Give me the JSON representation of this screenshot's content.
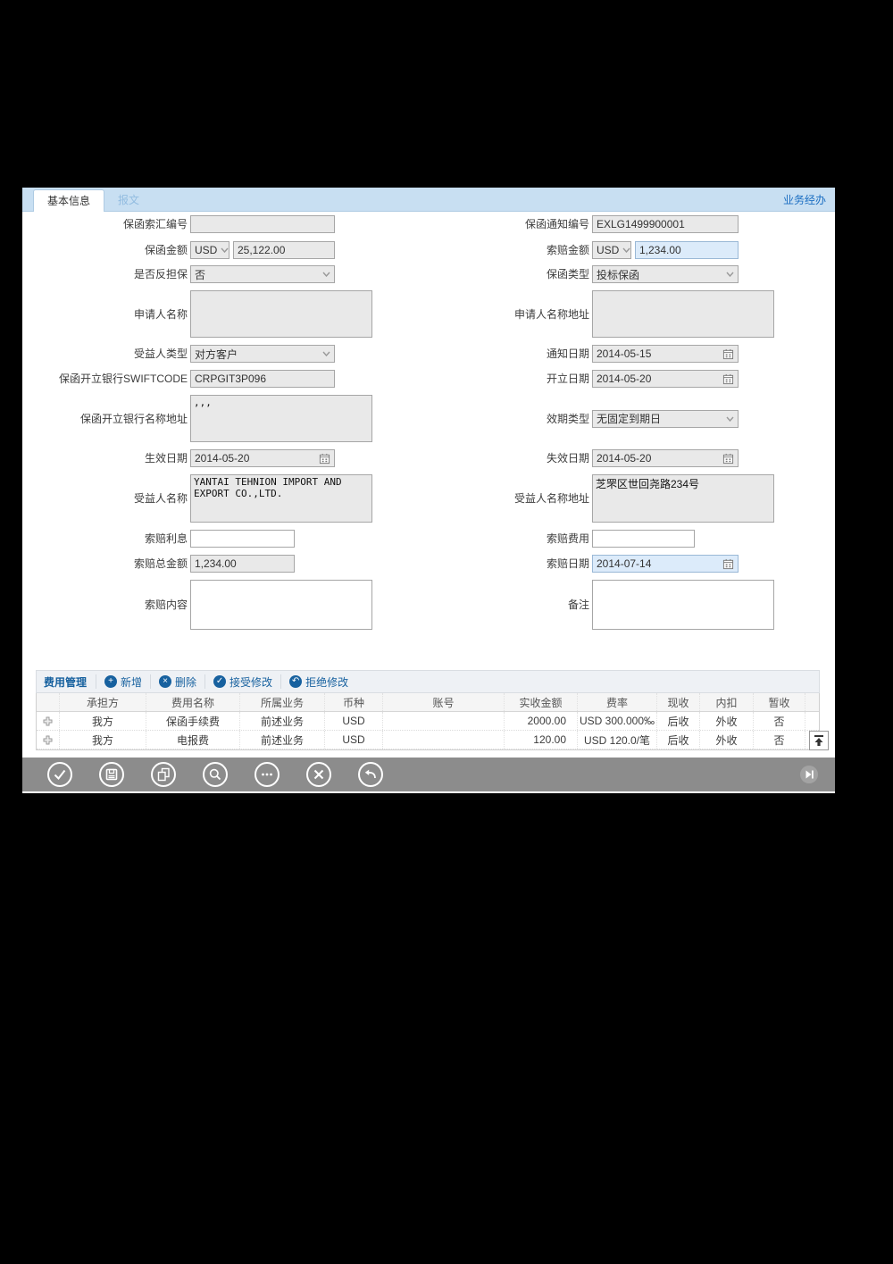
{
  "tabs": {
    "basic_info": "基本信息",
    "message": "报文"
  },
  "header": {
    "handler_link": "业务经办"
  },
  "fields": {
    "claim_remit_no": {
      "label": "保函索汇编号",
      "value": ""
    },
    "notice_no": {
      "label": "保函通知编号",
      "value": "EXLG1499900001"
    },
    "guarantee_amount": {
      "label": "保函金额",
      "currency": "USD",
      "value": "25,122.00"
    },
    "claim_amount": {
      "label": "索赔金额",
      "currency": "USD",
      "value": "1,234.00"
    },
    "counter_guarantee": {
      "label": "是否反担保",
      "value": "否"
    },
    "guarantee_type": {
      "label": "保函类型",
      "value": "投标保函"
    },
    "applicant_name": {
      "label": "申请人名称",
      "value": ""
    },
    "applicant_address": {
      "label": "申请人名称地址",
      "value": ""
    },
    "beneficiary_type": {
      "label": "受益人类型",
      "value": "对方客户"
    },
    "notice_date": {
      "label": "通知日期",
      "value": "2014-05-15"
    },
    "swift_code": {
      "label": "保函开立银行SWIFTCODE",
      "value": "CRPGIT3P096"
    },
    "issue_date": {
      "label": "开立日期",
      "value": "2014-05-20"
    },
    "issuing_bank_addr": {
      "label": "保函开立银行名称地址",
      "value": ",,,"
    },
    "validity_type": {
      "label": "效期类型",
      "value": "无固定到期日"
    },
    "effective_date": {
      "label": "生效日期",
      "value": "2014-05-20"
    },
    "expiry_date": {
      "label": "失效日期",
      "value": "2014-05-20"
    },
    "beneficiary_name": {
      "label": "受益人名称",
      "value": "YANTAI TEHNION IMPORT AND EXPORT CO.,LTD."
    },
    "beneficiary_address": {
      "label": "受益人名称地址",
      "value": "芝罘区世回尧路234号"
    },
    "claim_interest": {
      "label": "索赔利息",
      "value": ""
    },
    "claim_fee": {
      "label": "索赔费用",
      "value": ""
    },
    "claim_total": {
      "label": "索赔总金额",
      "value": "1,234.00"
    },
    "claim_date": {
      "label": "索赔日期",
      "value": "2014-07-14"
    },
    "claim_content": {
      "label": "索赔内容",
      "value": ""
    },
    "remarks": {
      "label": "备注",
      "value": ""
    }
  },
  "fee_section": {
    "title": "费用管理",
    "buttons": {
      "add": "新增",
      "delete": "删除",
      "accept": "接受修改",
      "reject": "拒绝修改"
    },
    "table": {
      "headers": [
        "承担方",
        "费用名称",
        "所属业务",
        "币种",
        "账号",
        "实收金额",
        "费率",
        "现收",
        "内扣",
        "暂收"
      ],
      "rows": [
        [
          "我方",
          "保函手续费",
          "前述业务",
          "USD",
          "",
          "2000.00",
          "USD 300.000‰",
          "后收",
          "外收",
          "否"
        ],
        [
          "我方",
          "电报费",
          "前述业务",
          "USD",
          "",
          "120.00",
          "USD 120.0/笔",
          "后收",
          "外收",
          "否"
        ]
      ]
    }
  },
  "toolbar": {
    "icons": [
      "confirm",
      "save",
      "copy",
      "search",
      "more",
      "close",
      "back"
    ],
    "right_icon": "skip-to-end"
  },
  "colors": {
    "tabbar_bg": "#c8dff2",
    "accent_blue": "#17619f",
    "link_blue": "#1b6ec2",
    "readonly_bg": "#e9e9e9",
    "highlight_bg": "#dcebfa",
    "toolbar_gray": "#8c8c8c"
  }
}
